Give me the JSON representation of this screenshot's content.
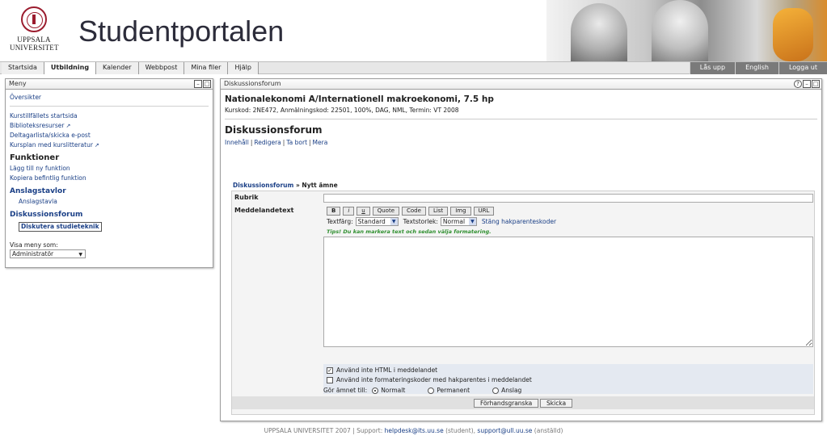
{
  "header": {
    "logo_line1": "UPPSALA",
    "logo_line2": "UNIVERSITET",
    "title": "Studentportalen"
  },
  "nav": {
    "tabs": [
      {
        "label": "Startsida"
      },
      {
        "label": "Utbildning"
      },
      {
        "label": "Kalender"
      },
      {
        "label": "Webbpost"
      },
      {
        "label": "Mina filer"
      },
      {
        "label": "Hjälp"
      }
    ],
    "active_tab": "Utbildning",
    "tools": [
      {
        "label": "Lås upp"
      },
      {
        "label": "English"
      },
      {
        "label": "Logga ut"
      }
    ]
  },
  "menu": {
    "title": "Meny",
    "overview": "Översikter",
    "links": [
      {
        "label": "Kurstillfällets startsida"
      },
      {
        "label": "Biblioteksresurser"
      },
      {
        "label": "Deltagarlista/skicka e-post"
      },
      {
        "label": "Kursplan med kurslitteratur"
      }
    ],
    "functions_heading": "Funktioner",
    "function_links": [
      {
        "label": "Lägg till ny funktion"
      },
      {
        "label": "Kopiera befintlig funktion"
      }
    ],
    "boards_heading": "Anslagstavlor",
    "board_link": "Anslagstavla",
    "forum_heading": "Diskussionsforum",
    "forum_current": "Diskutera studieteknik",
    "view_label": "Visa meny som:",
    "view_value": "Administratör"
  },
  "main": {
    "panel_title": "Diskussionsforum",
    "course_title": "Nationalekonomi A/Internationell makroekonomi, 7.5 hp",
    "course_info": "Kurskod: 2NE472, Anmälningskod: 22501, 100%, DAG, NML, Termin: VT 2008",
    "forum_title": "Diskussionsforum",
    "actions": [
      {
        "label": "Innehåll"
      },
      {
        "label": "Redigera"
      },
      {
        "label": "Ta bort"
      },
      {
        "label": "Mera"
      }
    ],
    "breadcrumb_link": "Diskussionsforum",
    "breadcrumb_sep": "»",
    "breadcrumb_current": "Nytt ämne"
  },
  "form": {
    "subject_label": "Rubrik",
    "subject_value": "",
    "message_label": "Meddelandetext",
    "bbcode_buttons": [
      "B",
      "i",
      "u",
      "Quote",
      "Code",
      "List",
      "Img",
      "URL"
    ],
    "text_color_label": "Textfärg:",
    "text_color_value": "Standard",
    "text_size_label": "Textstorlek:",
    "text_size_value": "Normal",
    "close_codes_link": "Stäng hakparenteskoder",
    "tip": "Tips! Du kan markera text och sedan välja formatering.",
    "message_value": "",
    "opt_no_html": "Använd inte HTML i meddelandet",
    "opt_no_html_checked": true,
    "opt_no_bbcode": "Använd inte formateringskoder med hakparentes i meddelandet",
    "opt_no_bbcode_checked": false,
    "topic_type_label": "Gör ämnet till:",
    "topic_types": [
      {
        "label": "Normalt",
        "selected": true
      },
      {
        "label": "Permanent",
        "selected": false
      },
      {
        "label": "Anslag",
        "selected": false
      }
    ],
    "preview_button": "Förhandsgranska",
    "send_button": "Skicka"
  },
  "footer": {
    "prefix": "UPPSALA UNIVERSITET 2007 | Support: ",
    "student_email": "helpdesk@its.uu.se",
    "student_suffix": " (student), ",
    "staff_email": "support@ull.uu.se",
    "staff_suffix": " (anställd)"
  },
  "colors": {
    "link": "#1a3f86",
    "tool_bg": "#7a7a7a",
    "tip": "#2f8f2f",
    "seal": "#9b1c2e"
  }
}
